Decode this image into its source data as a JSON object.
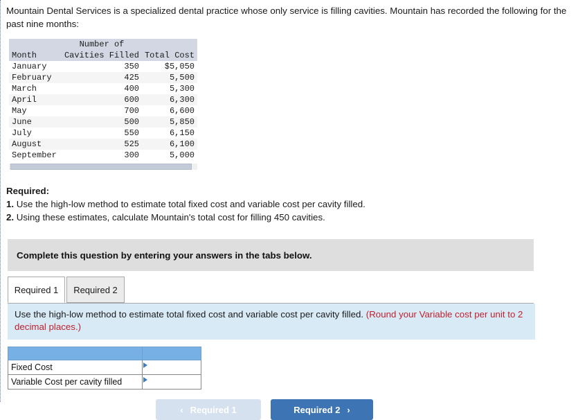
{
  "intro": "Mountain Dental Services is a specialized dental practice whose only service is filling cavities. Mountain has recorded the following for the past nine months:",
  "data_table": {
    "header_top": "Number of",
    "columns": [
      "Month",
      "Cavities Filled",
      "Total Cost"
    ],
    "rows": [
      {
        "month": "January",
        "cavities": "350",
        "cost": "$5,050"
      },
      {
        "month": "February",
        "cavities": "425",
        "cost": "5,500"
      },
      {
        "month": "March",
        "cavities": "400",
        "cost": "5,300"
      },
      {
        "month": "April",
        "cavities": "600",
        "cost": "6,300"
      },
      {
        "month": "May",
        "cavities": "700",
        "cost": "6,600"
      },
      {
        "month": "June",
        "cavities": "500",
        "cost": "5,850"
      },
      {
        "month": "July",
        "cavities": "550",
        "cost": "6,150"
      },
      {
        "month": "August",
        "cavities": "525",
        "cost": "6,100"
      },
      {
        "month": "September",
        "cavities": "300",
        "cost": "5,000"
      }
    ]
  },
  "required": {
    "title": "Required:",
    "item1_num": "1.",
    "item1_text": "Use the high-low method to estimate total fixed cost and variable cost per cavity filled.",
    "item2_num": "2.",
    "item2_text": "Using these estimates, calculate Mountain's total cost for filling 450 cavities."
  },
  "instruction_bar": {
    "text": "Complete this question by entering your answers in the tabs below."
  },
  "tabs": [
    {
      "label": "Required 1",
      "active": true
    },
    {
      "label": "Required 2",
      "active": false
    }
  ],
  "blue_panel": {
    "text": "Use the high-low method to estimate total fixed cost and variable cost per cavity filled.",
    "hint": "(Round your Variable cost per unit to 2 decimal places.)"
  },
  "answer_table": {
    "rows": [
      {
        "label": "Fixed Cost",
        "value": ""
      },
      {
        "label": "Variable Cost per cavity filled",
        "value": ""
      }
    ]
  },
  "nav": {
    "prev_label": "Required 1",
    "prev_chevron": "‹",
    "next_label": "Required 2",
    "next_chevron": "›"
  },
  "colors": {
    "accent_blue": "#3c74b4",
    "header_blue": "#77b0e4",
    "panel_blue": "#d9eaf7",
    "grey_bar": "#dedede",
    "hint_red": "#c0202c",
    "table_header": "#d2d7e3"
  }
}
